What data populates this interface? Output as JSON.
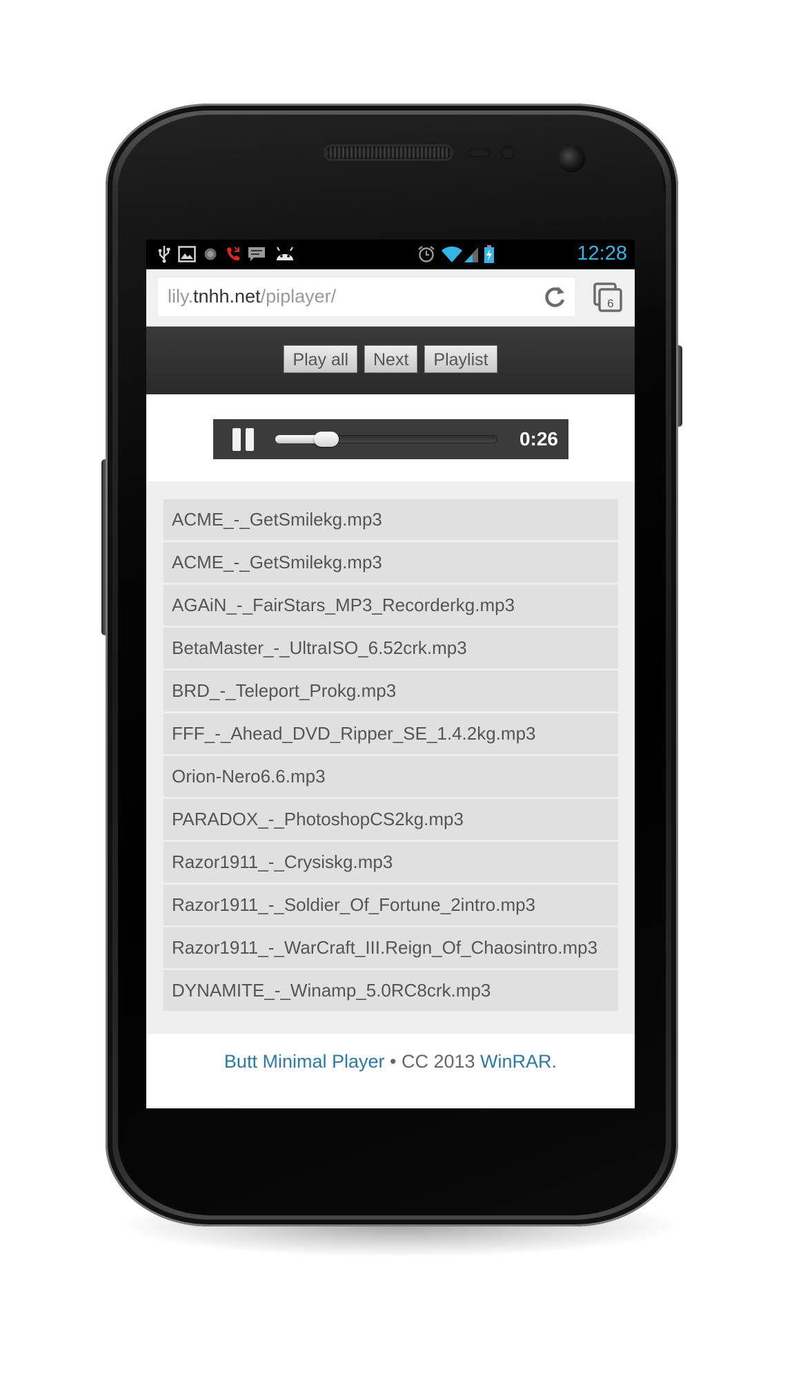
{
  "browser": {
    "url_prefix": "lily.",
    "url_host": "tnhh.net",
    "url_path": "/piplayer/",
    "reload_icon": "reload-icon",
    "tabs_icon": "tabs-icon",
    "tab_count": "6"
  },
  "status_bar": {
    "time": "12:28",
    "left_icons": [
      "usb-icon",
      "image-icon",
      "record-icon",
      "missed-call-icon",
      "message-icon",
      "android-icon"
    ],
    "right_icons": [
      "alarm-icon",
      "wifi-icon",
      "signal-icon",
      "battery-charging-icon"
    ],
    "time_color": "#33b5e5"
  },
  "controls": {
    "play_all": "Play all",
    "next": "Next",
    "playlist": "Playlist"
  },
  "player": {
    "state": "playing",
    "time": "0:26",
    "progress": 0.23
  },
  "playlist": [
    "ACME_-_GetSmilekg.mp3",
    "ACME_-_GetSmilekg.mp3",
    "AGAiN_-_FairStars_MP3_Recorderkg.mp3",
    "BetaMaster_-_UltraISO_6.52crk.mp3",
    "BRD_-_Teleport_Prokg.mp3",
    "FFF_-_Ahead_DVD_Ripper_SE_1.4.2kg.mp3",
    "Orion-Nero6.6.mp3",
    "PARADOX_-_PhotoshopCS2kg.mp3",
    "Razor1911_-_Crysiskg.mp3",
    "Razor1911_-_Soldier_Of_Fortune_2intro.mp3",
    "Razor1911_-_WarCraft_III.Reign_Of_Chaosintro.mp3",
    "DYNAMITE_-_Winamp_5.0RC8crk.mp3"
  ],
  "footer": {
    "link1": "Butt Minimal Player",
    "middle": " • CC 2013 ",
    "link2": "WinRAR",
    "end": ".",
    "link_color": "#2a7aa8"
  }
}
